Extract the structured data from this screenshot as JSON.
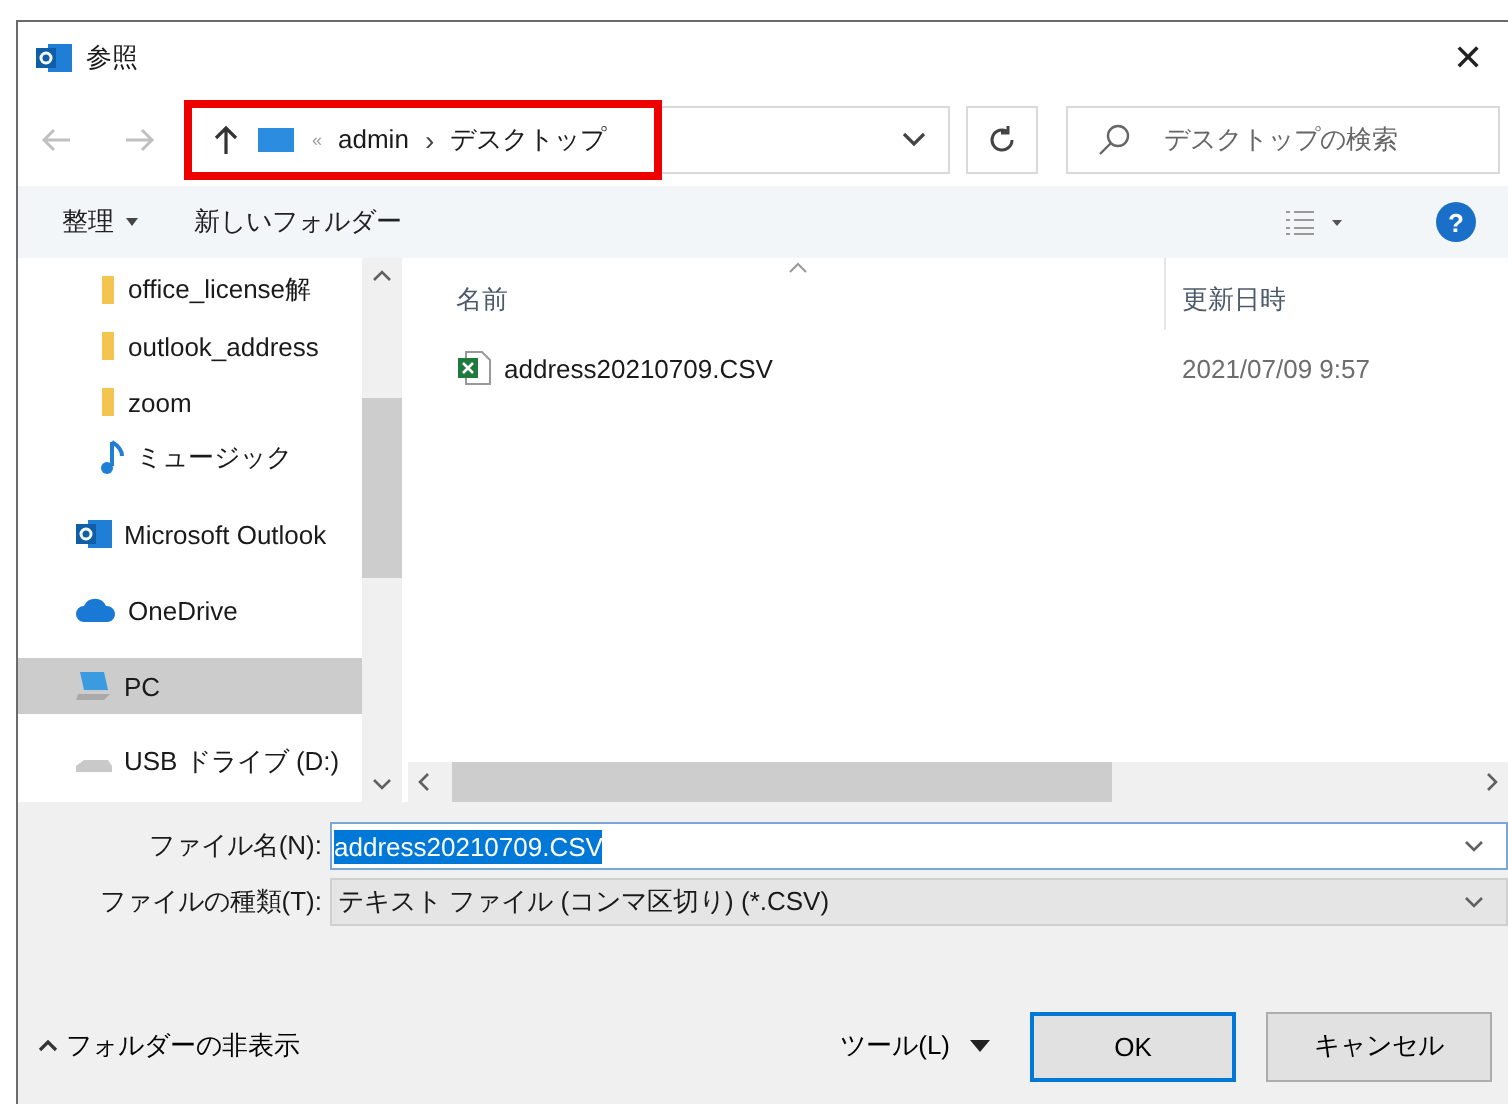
{
  "window": {
    "title": "参照",
    "close": "✕"
  },
  "address_bar": {
    "highlighted": true,
    "overflow": "«",
    "path": [
      "admin",
      "デスクトップ"
    ],
    "separator": "›"
  },
  "search": {
    "placeholder": "デスクトップの検索"
  },
  "toolbar": {
    "organize": "整理",
    "new_folder": "新しいフォルダー",
    "help": "?"
  },
  "sidebar": {
    "items": [
      {
        "kind": "folder",
        "label": "office_license解",
        "selected": false
      },
      {
        "kind": "folder",
        "label": "outlook_address",
        "selected": false
      },
      {
        "kind": "folder",
        "label": "zoom",
        "selected": false
      },
      {
        "kind": "music",
        "label": "ミュージック",
        "selected": false
      },
      {
        "kind": "outlook",
        "label": "Microsoft Outlook",
        "selected": false
      },
      {
        "kind": "cloud",
        "label": "OneDrive",
        "selected": false
      },
      {
        "kind": "pc",
        "label": "PC",
        "selected": true
      },
      {
        "kind": "drive",
        "label": "USB ドライブ (D:)",
        "selected": false
      }
    ]
  },
  "file_list": {
    "columns": [
      "名前",
      "更新日時"
    ],
    "rows": [
      {
        "name": "address20210709.CSV",
        "modified": "2021/07/09 9:57"
      }
    ]
  },
  "file_name": {
    "label": "ファイル名(N):",
    "value": "address20210709.CSV"
  },
  "file_type": {
    "label": "ファイルの種類(T):",
    "value": "テキスト ファイル (コンマ区切り) (*.CSV)"
  },
  "footer": {
    "hide_folders": "フォルダーの非表示",
    "tools": "ツール(L)",
    "ok": "OK",
    "cancel": "キャンセル"
  }
}
